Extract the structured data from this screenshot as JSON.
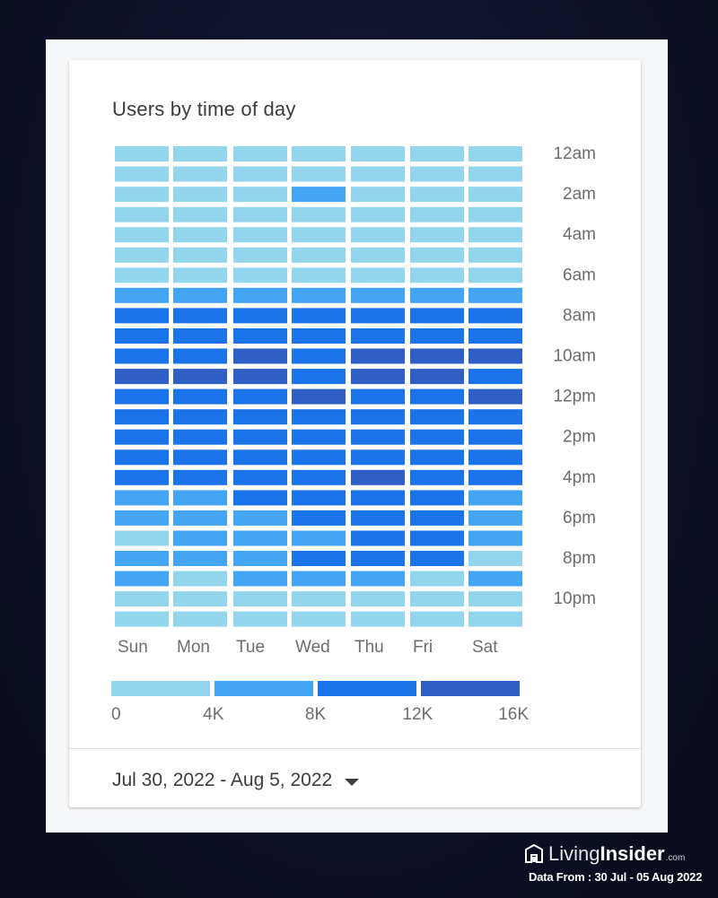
{
  "card": {
    "title": "Users by time of day",
    "date_range": "Jul 30, 2022 - Aug 5, 2022"
  },
  "branding": {
    "logo_icon": "house-logo-icon",
    "name_part1": "Living",
    "name_part2": "Insider",
    "suffix": ".com",
    "data_from": "Data From : 30 Jul - 05 Aug 2022"
  },
  "chart_data": {
    "type": "heatmap",
    "title": "Users by time of day",
    "x_categories": [
      "Sun",
      "Mon",
      "Tue",
      "Wed",
      "Thu",
      "Fri",
      "Sat"
    ],
    "y_categories": [
      "12am",
      "1am",
      "2am",
      "3am",
      "4am",
      "5am",
      "6am",
      "7am",
      "8am",
      "9am",
      "10am",
      "11am",
      "12pm",
      "1pm",
      "2pm",
      "3pm",
      "4pm",
      "5pm",
      "6pm",
      "7pm",
      "8pm",
      "9pm",
      "10pm",
      "11pm"
    ],
    "y_tick_labels": [
      "12am",
      "2am",
      "4am",
      "6am",
      "8am",
      "10am",
      "12pm",
      "2pm",
      "4pm",
      "6pm",
      "8pm",
      "10pm"
    ],
    "value_unit": "users (binned; values are bin midpoints)",
    "bins": [
      {
        "range": [
          0,
          4000
        ],
        "color": "#93d5ed"
      },
      {
        "range": [
          4000,
          8000
        ],
        "color": "#45a5f5"
      },
      {
        "range": [
          8000,
          12000
        ],
        "color": "#1a73e8"
      },
      {
        "range": [
          12000,
          16000
        ],
        "color": "#2f5ec4"
      }
    ],
    "legend_ticks": [
      "0",
      "4K",
      "8K",
      "12K",
      "16K"
    ],
    "legend_position": "bottom",
    "values": [
      [
        2000,
        2000,
        2000,
        2000,
        2000,
        2000,
        2000
      ],
      [
        2000,
        2000,
        2000,
        2000,
        2000,
        2000,
        2000
      ],
      [
        2000,
        2000,
        2000,
        6000,
        2000,
        2000,
        2000
      ],
      [
        2000,
        2000,
        2000,
        2000,
        2000,
        2000,
        2000
      ],
      [
        2000,
        2000,
        2000,
        2000,
        2000,
        2000,
        2000
      ],
      [
        2000,
        2000,
        2000,
        2000,
        2000,
        2000,
        2000
      ],
      [
        2000,
        2000,
        2000,
        2000,
        2000,
        2000,
        2000
      ],
      [
        6000,
        6000,
        6000,
        6000,
        6000,
        6000,
        6000
      ],
      [
        10000,
        10000,
        10000,
        10000,
        10000,
        10000,
        10000
      ],
      [
        10000,
        10000,
        10000,
        10000,
        10000,
        10000,
        10000
      ],
      [
        10000,
        10000,
        14000,
        10000,
        14000,
        14000,
        14000
      ],
      [
        14000,
        14000,
        14000,
        10000,
        14000,
        14000,
        10000
      ],
      [
        10000,
        10000,
        10000,
        14000,
        10000,
        10000,
        14000
      ],
      [
        10000,
        10000,
        10000,
        10000,
        10000,
        10000,
        10000
      ],
      [
        10000,
        10000,
        10000,
        10000,
        10000,
        10000,
        10000
      ],
      [
        10000,
        10000,
        10000,
        10000,
        10000,
        10000,
        10000
      ],
      [
        10000,
        10000,
        10000,
        10000,
        14000,
        10000,
        10000
      ],
      [
        6000,
        6000,
        10000,
        10000,
        10000,
        10000,
        6000
      ],
      [
        6000,
        6000,
        6000,
        10000,
        10000,
        10000,
        6000
      ],
      [
        2000,
        6000,
        6000,
        6000,
        10000,
        10000,
        6000
      ],
      [
        6000,
        6000,
        6000,
        10000,
        10000,
        10000,
        2000
      ],
      [
        6000,
        2000,
        6000,
        6000,
        6000,
        2000,
        6000
      ],
      [
        2000,
        2000,
        2000,
        2000,
        2000,
        2000,
        2000
      ],
      [
        2000,
        2000,
        2000,
        2000,
        2000,
        2000,
        2000
      ]
    ]
  }
}
